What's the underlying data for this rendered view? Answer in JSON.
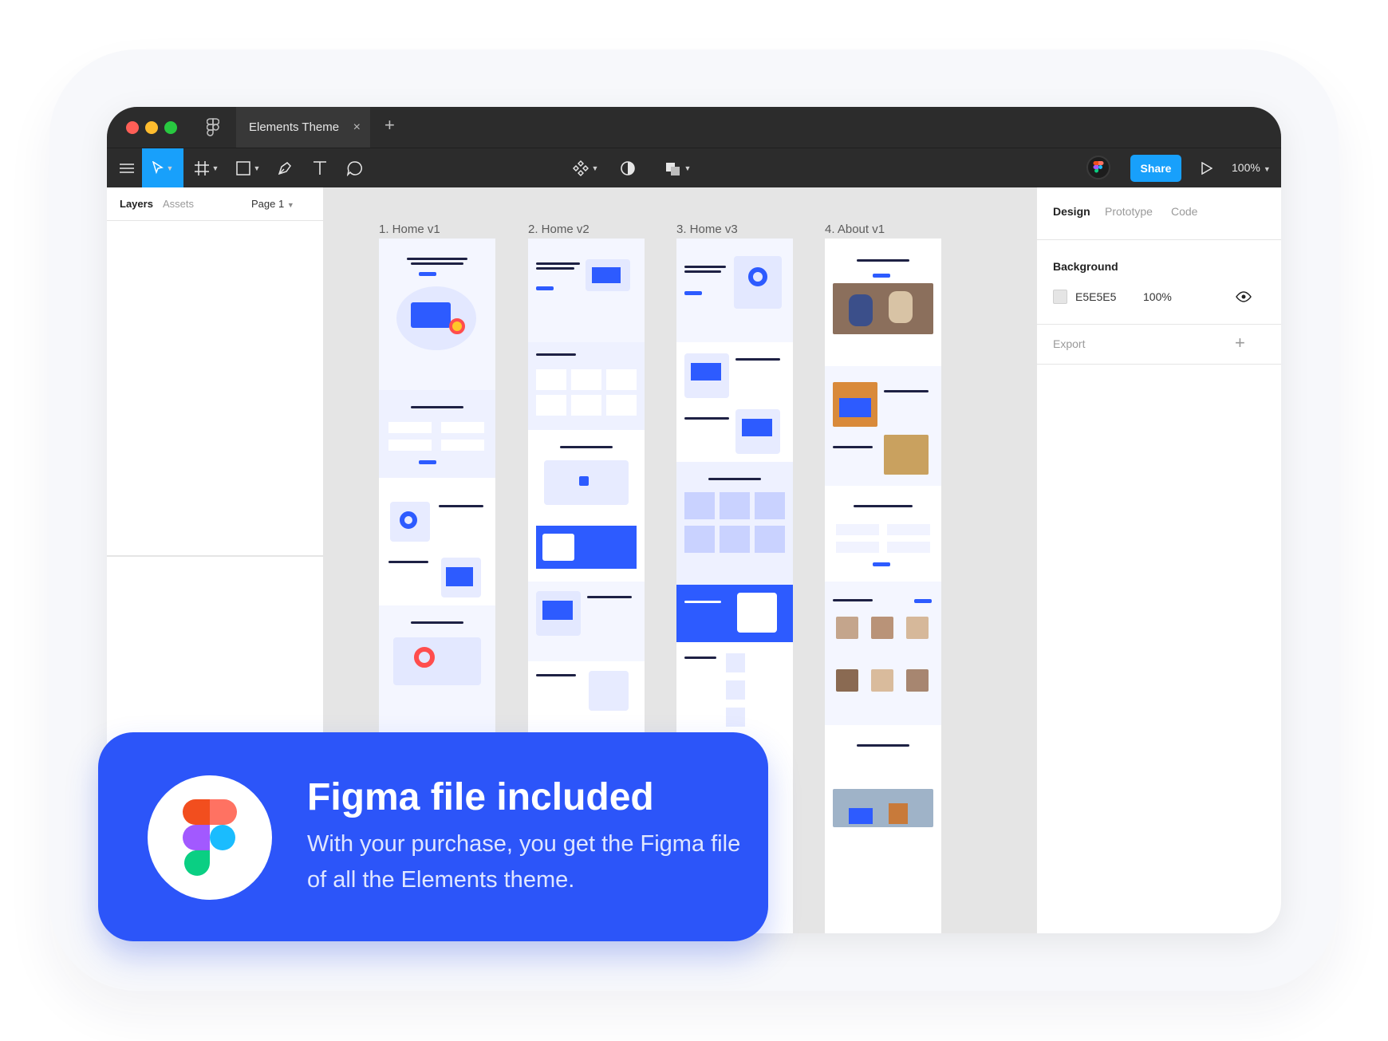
{
  "window": {
    "tab_title": "Elements Theme",
    "tab_close": "×",
    "tab_add": "+"
  },
  "toolbar": {
    "share_label": "Share",
    "zoom": "100%",
    "tools": [
      "menu-icon",
      "move-icon",
      "frame-icon",
      "rectangle-icon",
      "pen-icon",
      "text-icon",
      "comment-icon",
      "component-icon",
      "mask-icon",
      "boolean-icon",
      "play-icon"
    ]
  },
  "left_panel": {
    "tabs": [
      "Layers",
      "Assets"
    ],
    "page": "Page 1"
  },
  "canvas": {
    "frames": [
      {
        "label": "1. Home v1"
      },
      {
        "label": "2. Home v2"
      },
      {
        "label": "3. Home v3"
      },
      {
        "label": "4. About v1"
      }
    ]
  },
  "right_panel": {
    "tabs": [
      "Design",
      "Prototype",
      "Code"
    ],
    "background_label": "Background",
    "bg_hex": "E5E5E5",
    "bg_opacity": "100%",
    "export_label": "Export",
    "export_add": "+"
  },
  "banner": {
    "title": "Figma file included",
    "text": "With your purchase, you get the Figma file of all the Elements theme."
  },
  "colors": {
    "accent": "#2c55f9",
    "figma_blue": "#18a0fb",
    "titlebar": "#2c2c2c",
    "canvas": "#e5e5e5",
    "mac_red": "#ff5f57",
    "mac_yellow": "#febc2e",
    "mac_green": "#28c840"
  }
}
